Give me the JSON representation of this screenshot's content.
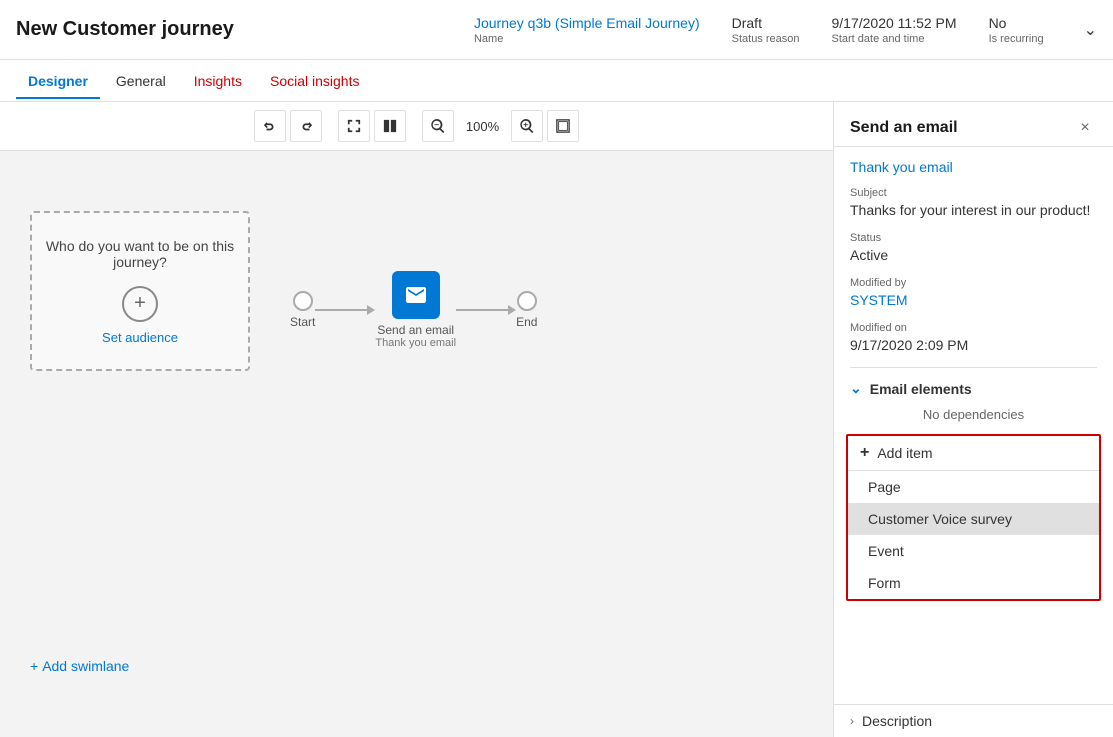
{
  "header": {
    "title": "New Customer journey",
    "fields": {
      "name_value": "Journey q3b (Simple Email Journey)",
      "name_label": "Name",
      "status_value": "Draft",
      "status_label": "Status reason",
      "date_value": "9/17/2020 11:52 PM",
      "date_label": "Start date and time",
      "recurring_value": "No",
      "recurring_label": "Is recurring"
    }
  },
  "tabs": {
    "items": [
      {
        "label": "Designer",
        "active": true,
        "color": "blue"
      },
      {
        "label": "General",
        "active": false,
        "color": "normal"
      },
      {
        "label": "Insights",
        "active": false,
        "color": "red"
      },
      {
        "label": "Social insights",
        "active": false,
        "color": "red"
      }
    ]
  },
  "toolbar": {
    "undo": "↩",
    "redo": "↪",
    "expand": "⤢",
    "split": "⊞",
    "zoom_out": "🔍-",
    "zoom_level": "100%",
    "zoom_in": "🔍+",
    "fit": "▣"
  },
  "canvas": {
    "audience_text": "Who do you want to be on this journey?",
    "set_audience": "Set audience",
    "add_swimlane": "Add swimlane",
    "node_start": "Start",
    "node_end": "End",
    "email_node_title": "Send an email",
    "email_node_subtitle": "Thank you email"
  },
  "panel": {
    "title": "Send an email",
    "link": "Thank you email",
    "subject_label": "Subject",
    "subject_value": "Thanks for your interest in our product!",
    "status_label": "Status",
    "status_value": "Active",
    "modified_by_label": "Modified by",
    "modified_by_value": "SYSTEM",
    "modified_on_label": "Modified on",
    "modified_on_value": "9/17/2020 2:09 PM",
    "email_elements_label": "Email elements",
    "no_dependencies": "No dependencies",
    "add_item_label": "Add item",
    "dropdown_items": [
      {
        "label": "Page",
        "highlighted": false
      },
      {
        "label": "Customer Voice survey",
        "highlighted": true
      },
      {
        "label": "Event",
        "highlighted": false
      },
      {
        "label": "Form",
        "highlighted": false
      }
    ],
    "description_label": "Description",
    "close_label": "×"
  }
}
